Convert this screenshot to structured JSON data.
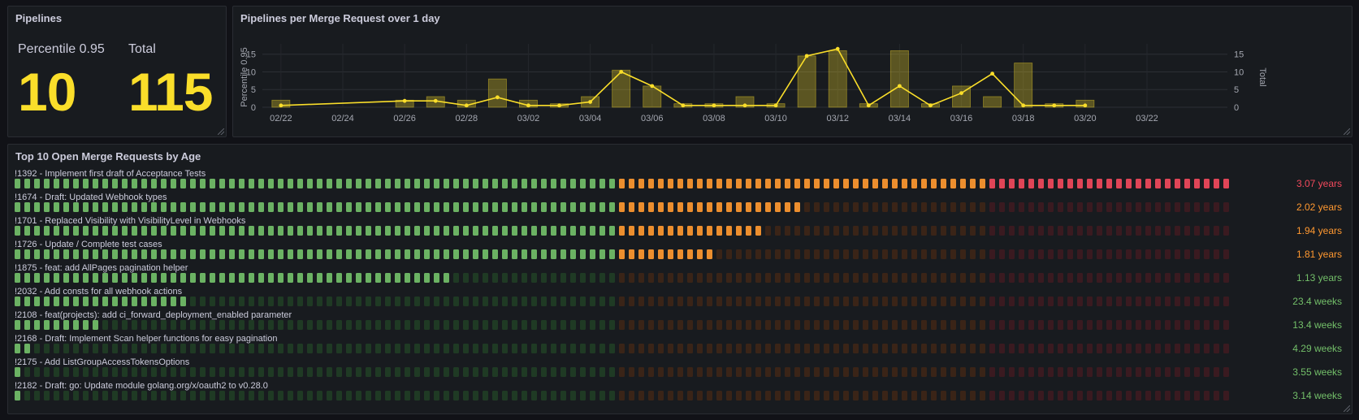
{
  "colors": {
    "green": "#73bf69",
    "orange": "#ff9830",
    "red": "#f2495c",
    "yellow": "#fade2a",
    "green_dim": "#1f3a24",
    "orange_dim": "#3a2417",
    "red_dim": "#3a1a20"
  },
  "stats_panel": {
    "title": "Pipelines",
    "p95_label": "Percentile 0.95",
    "p95_value": "10",
    "total_label": "Total",
    "total_value": "115"
  },
  "chart_panel": {
    "title": "Pipelines per Merge Request over 1 day"
  },
  "chart_data": {
    "type": "bar",
    "title": "Pipelines per Merge Request over 1 day",
    "x_tick_labels": [
      "02/22",
      "02/24",
      "02/26",
      "02/28",
      "03/02",
      "03/04",
      "03/06",
      "03/08",
      "03/10",
      "03/12",
      "03/14",
      "03/16",
      "03/18",
      "03/20",
      "03/22"
    ],
    "ylabel_left": "Percentile 0.95",
    "ylabel_right": "Total",
    "yticks": [
      0,
      5,
      10,
      15
    ],
    "ylim": [
      0,
      17
    ],
    "x_range_days": [
      -0.6,
      30.6
    ],
    "series": [
      {
        "name": "Total",
        "type": "bar",
        "axis": "right",
        "color": "#fade2a",
        "x_days": [
          0,
          4,
          5,
          6,
          7,
          8,
          9,
          10,
          11,
          12,
          13,
          14,
          15,
          16,
          17,
          18,
          19,
          20,
          21,
          22,
          23,
          24,
          25,
          26,
          27,
          28
        ],
        "values": [
          2,
          2,
          3,
          2,
          8,
          2,
          1,
          3,
          10.5,
          6,
          1,
          1,
          3,
          1,
          14.5,
          16,
          1,
          16,
          1,
          6,
          3,
          12.5,
          1,
          2,
          0,
          0
        ]
      },
      {
        "name": "Percentile 0.95",
        "type": "line",
        "axis": "left",
        "color": "#fade2a",
        "x_days": [
          0,
          4,
          5,
          6,
          7,
          8,
          9,
          10,
          11,
          12,
          13,
          14,
          15,
          16,
          17,
          18,
          19,
          20,
          21,
          22,
          23,
          24,
          25,
          26
        ],
        "values": [
          0.5,
          1.8,
          1.8,
          0.5,
          2.8,
          0.5,
          0.5,
          1.5,
          10,
          6,
          0.5,
          0.5,
          0.5,
          0.5,
          14.5,
          16.5,
          0.5,
          6,
          0.5,
          4,
          9.5,
          0.5,
          0.5,
          0.5
        ]
      }
    ]
  },
  "mr_panel": {
    "title": "Top 10 Open Merge Requests by Age",
    "gauge_cells": 125,
    "thresholds": {
      "orange_from": 62,
      "red_from": 100
    },
    "rows": [
      {
        "label": "!1392 - Implement first draft of Acceptance Tests",
        "value": "3.07",
        "unit": "years",
        "level": "red",
        "fill_cells": 125
      },
      {
        "label": "!1674 - Draft: Updated Webhook types",
        "value": "2.02",
        "unit": "years",
        "level": "orange",
        "fill_cells": 81
      },
      {
        "label": "!1701 - Replaced Visibility with VisibilityLevel in Webhooks",
        "value": "1.94",
        "unit": "years",
        "level": "orange",
        "fill_cells": 77
      },
      {
        "label": "!1726 - Update / Complete test cases",
        "value": "1.81",
        "unit": "years",
        "level": "orange",
        "fill_cells": 72
      },
      {
        "label": "!1875 - feat: add AllPages pagination helper",
        "value": "1.13",
        "unit": "years",
        "level": "green",
        "fill_cells": 45
      },
      {
        "label": "!2032 - Add consts for all webhook actions",
        "value": "23.4",
        "unit": "weeks",
        "level": "green",
        "fill_cells": 18
      },
      {
        "label": "!2108 - feat(projects): add ci_forward_deployment_enabled parameter",
        "value": "13.4",
        "unit": "weeks",
        "level": "green",
        "fill_cells": 9
      },
      {
        "label": "!2168 - Draft: Implement Scan helper functions for easy pagination",
        "value": "4.29",
        "unit": "weeks",
        "level": "green",
        "fill_cells": 2
      },
      {
        "label": "!2175 - Add ListGroupAccessTokensOptions",
        "value": "3.55",
        "unit": "weeks",
        "level": "green",
        "fill_cells": 1
      },
      {
        "label": "!2182 - Draft: go: Update module golang.org/x/oauth2 to v0.28.0",
        "value": "3.14",
        "unit": "weeks",
        "level": "green",
        "fill_cells": 1
      }
    ]
  }
}
